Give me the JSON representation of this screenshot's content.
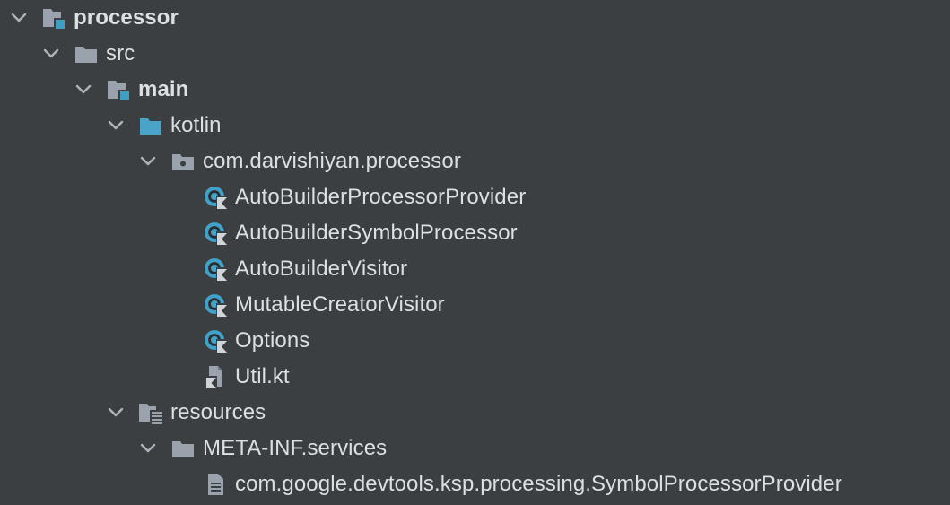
{
  "colors": {
    "background": "#3c3f41",
    "text": "#dcdfe4",
    "folder_gray": "#9aa3ad",
    "source_folder_blue": "#4aa3c8",
    "kotlin_class_blue": "#40a2c9",
    "module_square": "#3f9ec2"
  },
  "tree": {
    "root": {
      "label": "processor",
      "icon": "module-folder-icon"
    },
    "src": {
      "label": "src",
      "icon": "folder-icon"
    },
    "main": {
      "label": "main",
      "icon": "module-folder-icon"
    },
    "kotlin": {
      "label": "kotlin",
      "icon": "source-root-folder-icon"
    },
    "package": {
      "label": "com.darvishiyan.processor",
      "icon": "package-icon"
    },
    "files": [
      {
        "label": "AutoBuilderProcessorProvider",
        "icon": "kotlin-class-icon"
      },
      {
        "label": "AutoBuilderSymbolProcessor",
        "icon": "kotlin-class-icon"
      },
      {
        "label": "AutoBuilderVisitor",
        "icon": "kotlin-class-icon"
      },
      {
        "label": "MutableCreatorVisitor",
        "icon": "kotlin-class-icon"
      },
      {
        "label": "Options",
        "icon": "kotlin-class-icon"
      },
      {
        "label": "Util.kt",
        "icon": "kotlin-file-icon"
      }
    ],
    "resources": {
      "label": "resources",
      "icon": "resources-folder-icon"
    },
    "meta_inf": {
      "label": "META-INF.services",
      "icon": "folder-icon"
    },
    "service_file": {
      "label": "com.google.devtools.ksp.processing.SymbolProcessorProvider",
      "icon": "text-file-icon"
    }
  }
}
